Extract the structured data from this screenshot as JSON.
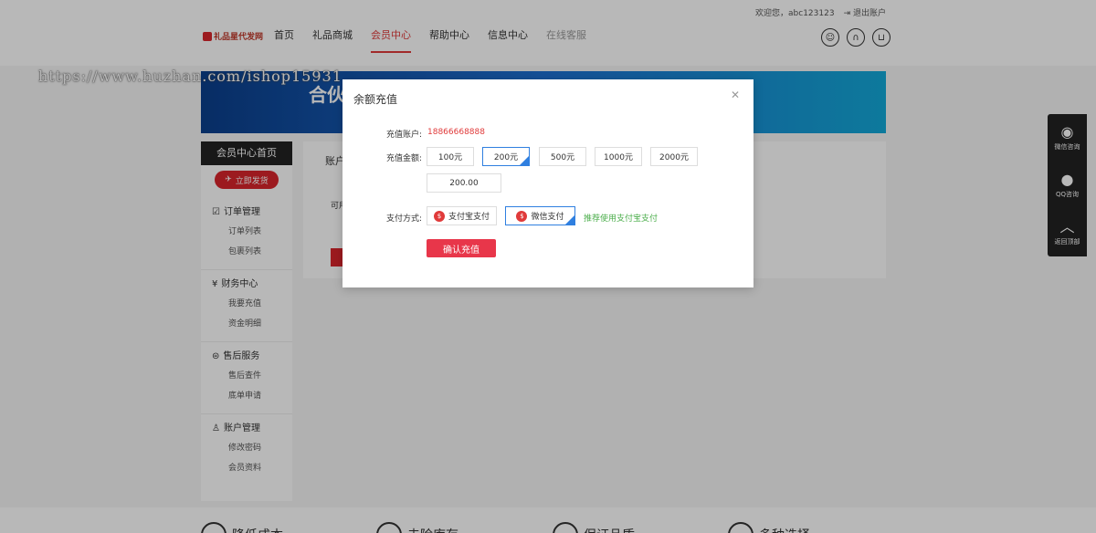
{
  "header": {
    "welcome": "欢迎您，abc123123",
    "logout": "退出账户",
    "logo_text": "礼品星代发网",
    "nav": [
      {
        "label": "首页",
        "state": "normal"
      },
      {
        "label": "礼品商城",
        "state": "normal"
      },
      {
        "label": "会员中心",
        "state": "active"
      },
      {
        "label": "帮助中心",
        "state": "normal"
      },
      {
        "label": "信息中心",
        "state": "normal"
      },
      {
        "label": "在线客服",
        "state": "muted"
      }
    ],
    "icons": [
      "user-icon",
      "headset-icon",
      "cart-icon"
    ]
  },
  "watermark": "https://www.huzhan.com/ishop15931",
  "banner": {
    "text": "合伙"
  },
  "sidebar": {
    "title": "会员中心首页",
    "quick_button": "立即发货",
    "groups": [
      {
        "title": "订单管理",
        "icon": "order-icon",
        "links": [
          "订单列表",
          "包裹列表"
        ]
      },
      {
        "title": "财务中心",
        "icon": "finance-icon",
        "links": [
          "我要充值",
          "资金明细"
        ]
      },
      {
        "title": "售后服务",
        "icon": "service-icon",
        "links": [
          "售后查件",
          "底单申请"
        ]
      },
      {
        "title": "账户管理",
        "icon": "account-icon",
        "links": [
          "修改密码",
          "会员资料"
        ]
      }
    ]
  },
  "content": {
    "tab": "账户",
    "line": "可用"
  },
  "bottom_features": [
    "降低成本",
    "去除库存",
    "保证品质",
    "多种选择"
  ],
  "float_bar": [
    {
      "label": "微信咨询",
      "icon": "wechat-icon"
    },
    {
      "label": "QQ咨询",
      "icon": "qq-icon"
    },
    {
      "label": "返回顶部",
      "icon": "arrow-up-icon"
    }
  ],
  "modal": {
    "title": "余额充值",
    "account_label": "充值账户:",
    "account_value": "18866668888",
    "amount_label": "充值金额:",
    "amounts": [
      "100元",
      "200元",
      "500元",
      "1000元",
      "2000元"
    ],
    "selected_amount_index": 1,
    "custom_amount_value": "200.00",
    "pay_label": "支付方式:",
    "pay_methods": [
      "支付宝支付",
      "微信支付"
    ],
    "selected_pay_index": 1,
    "recommend": "推荐使用支付宝支付",
    "confirm_label": "确认充值"
  },
  "colors": {
    "accent": "#e8364a",
    "selected_border": "#2f7fe0",
    "recommend": "#4cae4c"
  }
}
